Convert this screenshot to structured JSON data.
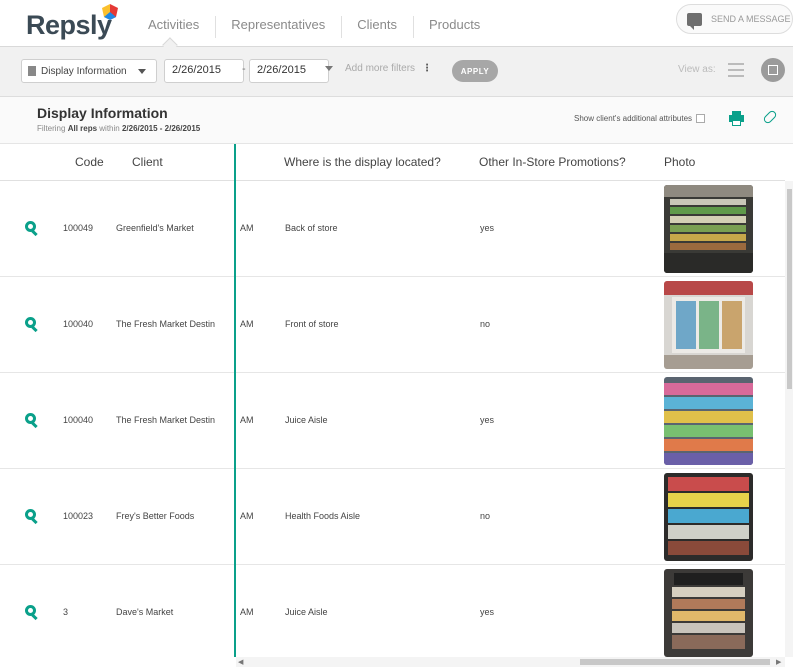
{
  "nav": {
    "logo": "Repsly",
    "tabs": [
      "Activities",
      "Representatives",
      "Clients",
      "Products"
    ],
    "active_tab": "Activities",
    "send_message": "SEND A MESSAGE"
  },
  "filters": {
    "report_type": "Display Information",
    "date_from": "2/26/2015",
    "date_to": "2/26/2015",
    "date_separator": "-",
    "add_filters": "Add more filters",
    "apply": "APPLY",
    "view_as": "View as:"
  },
  "report": {
    "title": "Display Information",
    "filter_prefix": "Filtering",
    "filter_reps": "All reps",
    "filter_mid": "within",
    "filter_range": "2/26/2015 - 2/26/2015",
    "show_attributes": "Show client's additional attributes"
  },
  "table": {
    "columns": {
      "code": "Code",
      "client": "Client",
      "location": "Where is the display located?",
      "promotions": "Other In-Store Promotions?",
      "photo": "Photo"
    },
    "rows": [
      {
        "code": "100049",
        "client": "Greenfield's Market",
        "time": "AM",
        "location": "Back of store",
        "promotions": "yes"
      },
      {
        "code": "100040",
        "client": "The Fresh Market Destin",
        "time": "AM",
        "location": "Front of store",
        "promotions": "no"
      },
      {
        "code": "100040",
        "client": "The Fresh Market Destin",
        "time": "AM",
        "location": "Juice Aisle",
        "promotions": "yes"
      },
      {
        "code": "100023",
        "client": "Frey's Better Foods",
        "time": "AM",
        "location": "Health Foods Aisle",
        "promotions": "no"
      },
      {
        "code": "3",
        "client": "Dave's Market",
        "time": "AM",
        "location": "Juice Aisle",
        "promotions": "yes"
      }
    ]
  },
  "colors": {
    "accent": "#0aa08a",
    "logo_text": "#3b4a55",
    "apply_bg": "#a7a7a7"
  }
}
